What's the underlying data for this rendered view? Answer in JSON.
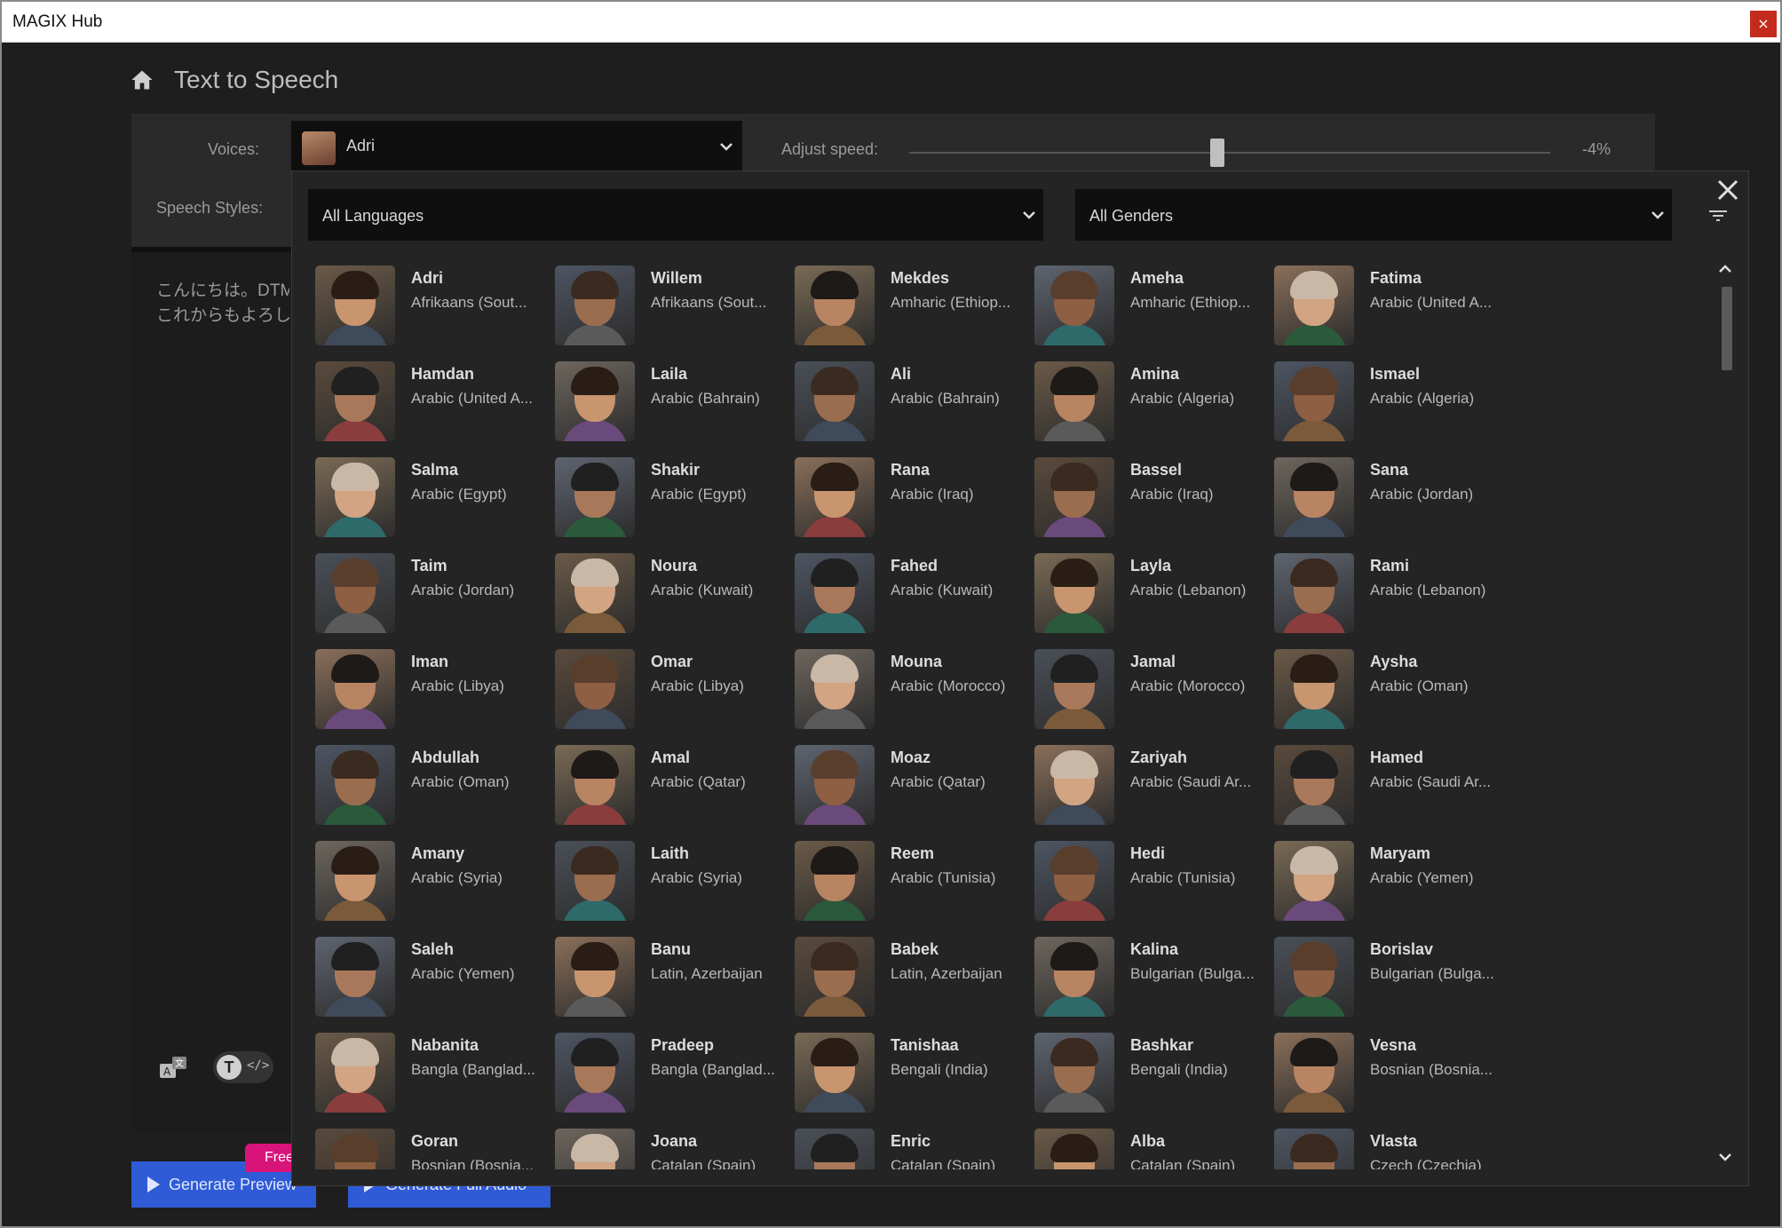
{
  "window": {
    "title": "MAGIX Hub",
    "close_glyph": "×"
  },
  "header": {
    "title": "Text to Speech",
    "home_icon": "home-icon"
  },
  "settings": {
    "voices_label": "Voices:",
    "selected_voice": "Adri",
    "speed_label": "Adjust speed:",
    "speed_value": "-4%",
    "speed_percent": -4,
    "styles_label": "Speech Styles:"
  },
  "editor": {
    "text_line1": "こんにちは。DTMフ",
    "text_line2": "これからもよろしく"
  },
  "tools": {
    "ssml_letter": "T",
    "ssml_code": "</>"
  },
  "actions": {
    "preview_label": "Generate Preview",
    "free_badge": "Free",
    "full_audio_label": "Generate Full Audio"
  },
  "popup": {
    "language_filter": "All Languages",
    "gender_filter": "All Genders",
    "voices": [
      {
        "name": "Adri",
        "lang": "Afrikaans (Sout..."
      },
      {
        "name": "Willem",
        "lang": "Afrikaans (Sout..."
      },
      {
        "name": "Mekdes",
        "lang": "Amharic (Ethiop..."
      },
      {
        "name": "Ameha",
        "lang": "Amharic (Ethiop..."
      },
      {
        "name": "Fatima",
        "lang": "Arabic (United A..."
      },
      {
        "name": "Hamdan",
        "lang": "Arabic (United A..."
      },
      {
        "name": "Laila",
        "lang": "Arabic (Bahrain)"
      },
      {
        "name": "Ali",
        "lang": "Arabic (Bahrain)"
      },
      {
        "name": "Amina",
        "lang": "Arabic (Algeria)"
      },
      {
        "name": "Ismael",
        "lang": "Arabic (Algeria)"
      },
      {
        "name": "Salma",
        "lang": "Arabic (Egypt)"
      },
      {
        "name": "Shakir",
        "lang": "Arabic (Egypt)"
      },
      {
        "name": "Rana",
        "lang": "Arabic (Iraq)"
      },
      {
        "name": "Bassel",
        "lang": "Arabic (Iraq)"
      },
      {
        "name": "Sana",
        "lang": "Arabic (Jordan)"
      },
      {
        "name": "Taim",
        "lang": "Arabic (Jordan)"
      },
      {
        "name": "Noura",
        "lang": "Arabic (Kuwait)"
      },
      {
        "name": "Fahed",
        "lang": "Arabic (Kuwait)"
      },
      {
        "name": "Layla",
        "lang": "Arabic (Lebanon)"
      },
      {
        "name": "Rami",
        "lang": "Arabic (Lebanon)"
      },
      {
        "name": "Iman",
        "lang": "Arabic (Libya)"
      },
      {
        "name": "Omar",
        "lang": "Arabic (Libya)"
      },
      {
        "name": "Mouna",
        "lang": "Arabic (Morocco)"
      },
      {
        "name": "Jamal",
        "lang": "Arabic (Morocco)"
      },
      {
        "name": "Aysha",
        "lang": "Arabic (Oman)"
      },
      {
        "name": "Abdullah",
        "lang": "Arabic (Oman)"
      },
      {
        "name": "Amal",
        "lang": "Arabic (Qatar)"
      },
      {
        "name": "Moaz",
        "lang": "Arabic (Qatar)"
      },
      {
        "name": "Zariyah",
        "lang": "Arabic (Saudi Ar..."
      },
      {
        "name": "Hamed",
        "lang": "Arabic (Saudi Ar..."
      },
      {
        "name": "Amany",
        "lang": "Arabic (Syria)"
      },
      {
        "name": "Laith",
        "lang": "Arabic (Syria)"
      },
      {
        "name": "Reem",
        "lang": "Arabic (Tunisia)"
      },
      {
        "name": "Hedi",
        "lang": "Arabic (Tunisia)"
      },
      {
        "name": "Maryam",
        "lang": "Arabic (Yemen)"
      },
      {
        "name": "Saleh",
        "lang": "Arabic (Yemen)"
      },
      {
        "name": "Banu",
        "lang": "Latin, Azerbaijan"
      },
      {
        "name": "Babek",
        "lang": "Latin, Azerbaijan"
      },
      {
        "name": "Kalina",
        "lang": "Bulgarian (Bulga..."
      },
      {
        "name": "Borislav",
        "lang": "Bulgarian (Bulga..."
      },
      {
        "name": "Nabanita",
        "lang": "Bangla (Banglad..."
      },
      {
        "name": "Pradeep",
        "lang": "Bangla (Banglad..."
      },
      {
        "name": "Tanishaa",
        "lang": "Bengali (India)"
      },
      {
        "name": "Bashkar",
        "lang": "Bengali (India)"
      },
      {
        "name": "Vesna",
        "lang": "Bosnian (Bosnia..."
      },
      {
        "name": "Goran",
        "lang": "Bosnian (Bosnia..."
      },
      {
        "name": "Joana",
        "lang": "Catalan (Spain)"
      },
      {
        "name": "Enric",
        "lang": "Catalan (Spain)"
      },
      {
        "name": "Alba",
        "lang": "Catalan (Spain)"
      },
      {
        "name": "Vlasta",
        "lang": "Czech (Czechia)"
      }
    ]
  }
}
